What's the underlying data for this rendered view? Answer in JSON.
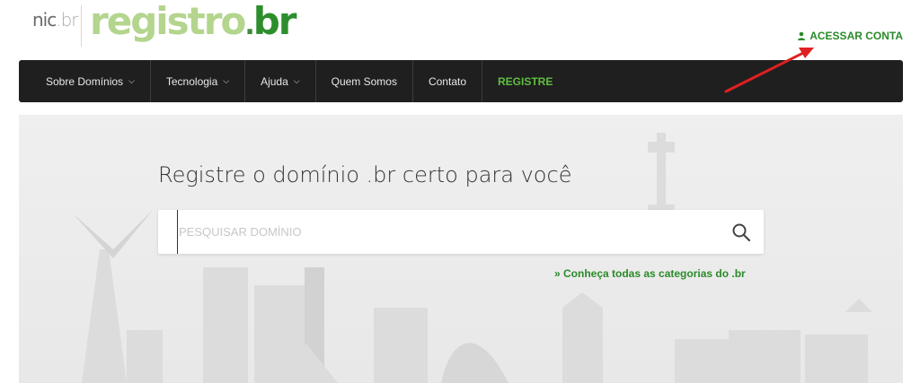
{
  "logo": {
    "nic": "nic",
    "nic_suffix": ".br",
    "registro": "registro",
    "registro_dot": ".",
    "registro_br": "br"
  },
  "header": {
    "login_label": "ACESSAR CONTA"
  },
  "nav": {
    "items": [
      {
        "label": "Sobre Domínios",
        "dropdown": true
      },
      {
        "label": "Tecnologia",
        "dropdown": true
      },
      {
        "label": "Ajuda",
        "dropdown": true
      },
      {
        "label": "Quem Somos",
        "dropdown": false
      },
      {
        "label": "Contato",
        "dropdown": false
      },
      {
        "label": "REGISTRE",
        "dropdown": false
      }
    ],
    "chevron": "⌄"
  },
  "hero": {
    "title": "Registre o domínio .br certo para você",
    "search_placeholder": "PESQUISAR DOMÍNIO",
    "categories_link": "» Conheça todas as categorias do .br"
  },
  "colors": {
    "brand_green": "#2a8a2a",
    "nav_bg": "#1f1f1f",
    "register_green": "#5fbf3f",
    "annotation_arrow": "#e02020"
  }
}
